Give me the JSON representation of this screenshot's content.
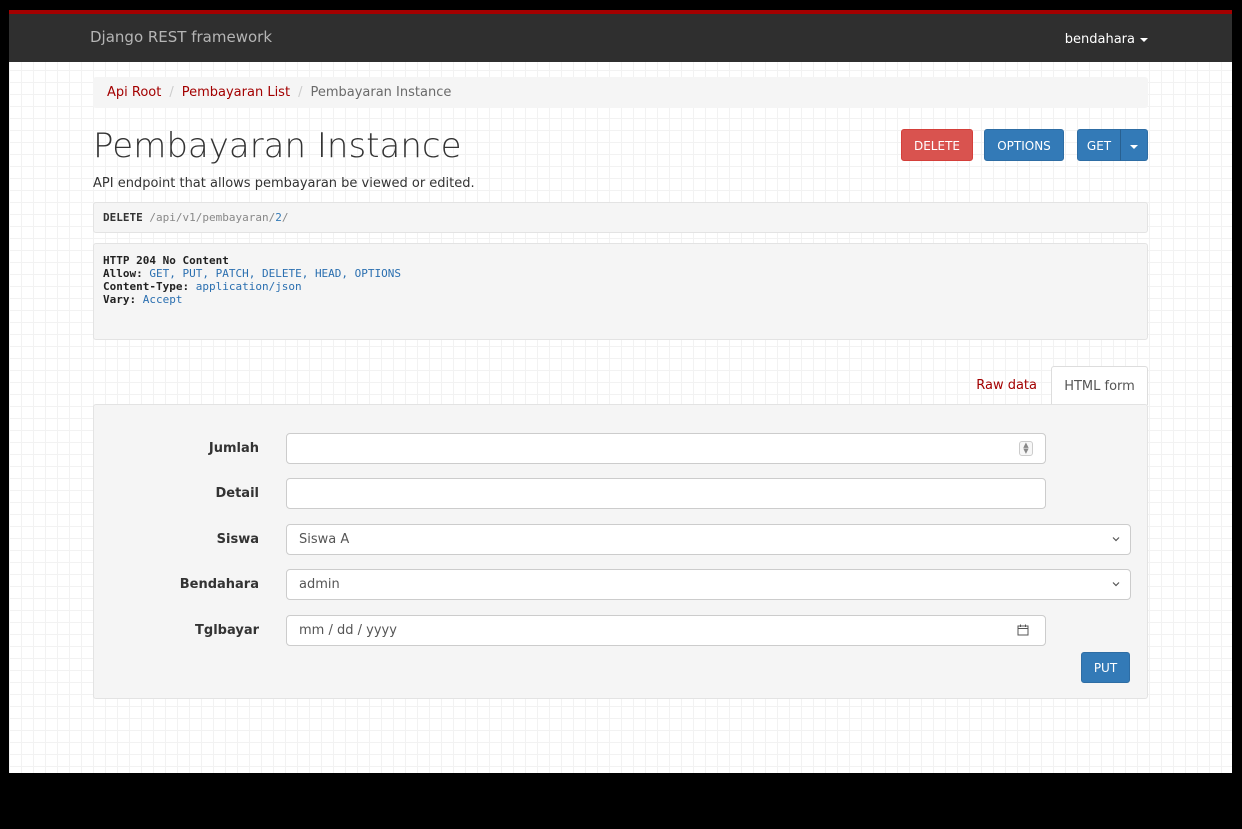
{
  "navbar": {
    "brand": "Django REST framework",
    "user": "bendahara"
  },
  "breadcrumb": {
    "items": [
      "Api Root",
      "Pembayaran List"
    ],
    "active": "Pembayaran Instance"
  },
  "page": {
    "title": "Pembayaran Instance",
    "description": "API endpoint that allows pembayaran be viewed or edited."
  },
  "actions": {
    "delete": "DELETE",
    "options": "OPTIONS",
    "get": "GET"
  },
  "request": {
    "method": "DELETE",
    "path": "/api/v1/pembayaran/",
    "pk": "2",
    "trailing": "/"
  },
  "response": {
    "status": "HTTP 204 No Content",
    "headers": [
      {
        "name": "Allow:",
        "value": "GET, PUT, PATCH, DELETE, HEAD, OPTIONS"
      },
      {
        "name": "Content-Type:",
        "value": "application/json"
      },
      {
        "name": "Vary:",
        "value": "Accept"
      }
    ]
  },
  "tabs": {
    "raw": "Raw data",
    "html": "HTML form"
  },
  "form": {
    "jumlah": {
      "label": "Jumlah",
      "value": ""
    },
    "detail": {
      "label": "Detail",
      "value": ""
    },
    "siswa": {
      "label": "Siswa",
      "value": "Siswa A"
    },
    "bendahara": {
      "label": "Bendahara",
      "value": "admin"
    },
    "tglbayar": {
      "label": "Tglbayar",
      "placeholder": "mm / dd / yyyy"
    },
    "submit": "PUT"
  }
}
